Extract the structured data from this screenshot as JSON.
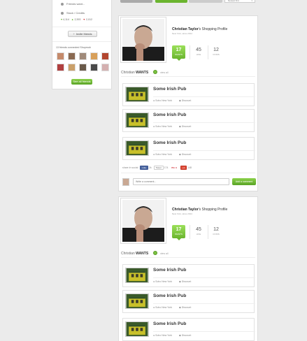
{
  "colors": {
    "accent_green": "#6bb52f",
    "page_bg": "#ebebeb",
    "card_bg": "#ffffff"
  },
  "top_bar": {
    "tab1": "",
    "tab2": "",
    "tab3": "",
    "sort_select": "Newest first"
  },
  "sidebar": {
    "friends_want": "Friends want...",
    "stock": "Stock / Credits",
    "stats": [
      "4,114",
      "2,393",
      "2,012"
    ],
    "stats_icons": [
      "heart-icon",
      "price-icon",
      "tag-icon"
    ],
    "invite_button": "Invite friends",
    "friends_label": "13 friends connected Shopmob",
    "see_all_button": "See all friends",
    "avatar_count": 10
  },
  "profile": {
    "user_name": "Christian Taylor",
    "suffix": "'s Shopping Profile",
    "subline": "New York, since 2014",
    "wants_count": "17",
    "wants_label": "WANTS",
    "likes_count": "45",
    "likes_label": "LIKE",
    "coins_count": "12",
    "coins_label": "COINS"
  },
  "wants_section": {
    "user": "Christian",
    "title_word": "WANTS",
    "view_all": "view all"
  },
  "items": [
    {
      "title": "Some Irish Pub",
      "location": "Soho New York",
      "tag": "Discount"
    },
    {
      "title": "Some Irish Pub",
      "location": "Soho New York",
      "tag": "Discount"
    },
    {
      "title": "Some Irish Pub",
      "location": "Soho New York",
      "tag": "Discount"
    }
  ],
  "share": {
    "label": "share in social",
    "like": "Like",
    "like_count": "2k",
    "tweet": "Tweet",
    "tweet_count": "174",
    "pin": "Pin it",
    "gplus": "+1",
    "gplus_count": "148"
  },
  "comment": {
    "placeholder": "Write a comment...",
    "post_button": "Add a comment"
  }
}
